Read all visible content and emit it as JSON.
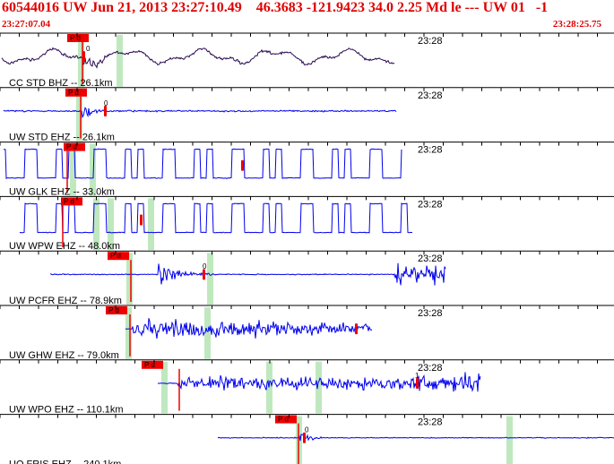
{
  "header": {
    "title": "60544016 UW Jun 21, 2013 23:27:10.49    46.3683 -121.9423 34.0 2.25 Md le --- UW 01   -1",
    "start_time": "23:27:07.04",
    "end_time": "23:28:25.75"
  },
  "colors": {
    "trace_first": "#2a0a50",
    "trace": "#0000ee",
    "pick": "#ee0000",
    "coda": "#bfe8bf",
    "text_red": "#e00000"
  },
  "minute_label": "23:28",
  "traces": [
    {
      "label": "CC STD BHZ -- 26.1km",
      "pick_label": "P d",
      "zero_label": "0"
    },
    {
      "label": "UW STD EHZ -- 26.1km",
      "pick_label": "P d",
      "zero_label": "0"
    },
    {
      "label": "UW GLK EHZ -- 33.0km",
      "pick_label": "P d",
      "zero_label": ""
    },
    {
      "label": "UW WPW EHZ -- 48.0km",
      "pick_label": "P d",
      "zero_label": ""
    },
    {
      "label": "UW PCFR EHZ -- 78.9km",
      "pick_label": "P d",
      "zero_label": "0"
    },
    {
      "label": "UW GHW EHZ -- 79.0km",
      "pick_label": "P d",
      "zero_label": ""
    },
    {
      "label": "UW WPO EHZ -- 110.1km",
      "pick_label": "P d",
      "zero_label": "1"
    },
    {
      "label": "UO FRIS EHZ -- 240.1km",
      "pick_label": "P d",
      "zero_label": "0"
    }
  ]
}
